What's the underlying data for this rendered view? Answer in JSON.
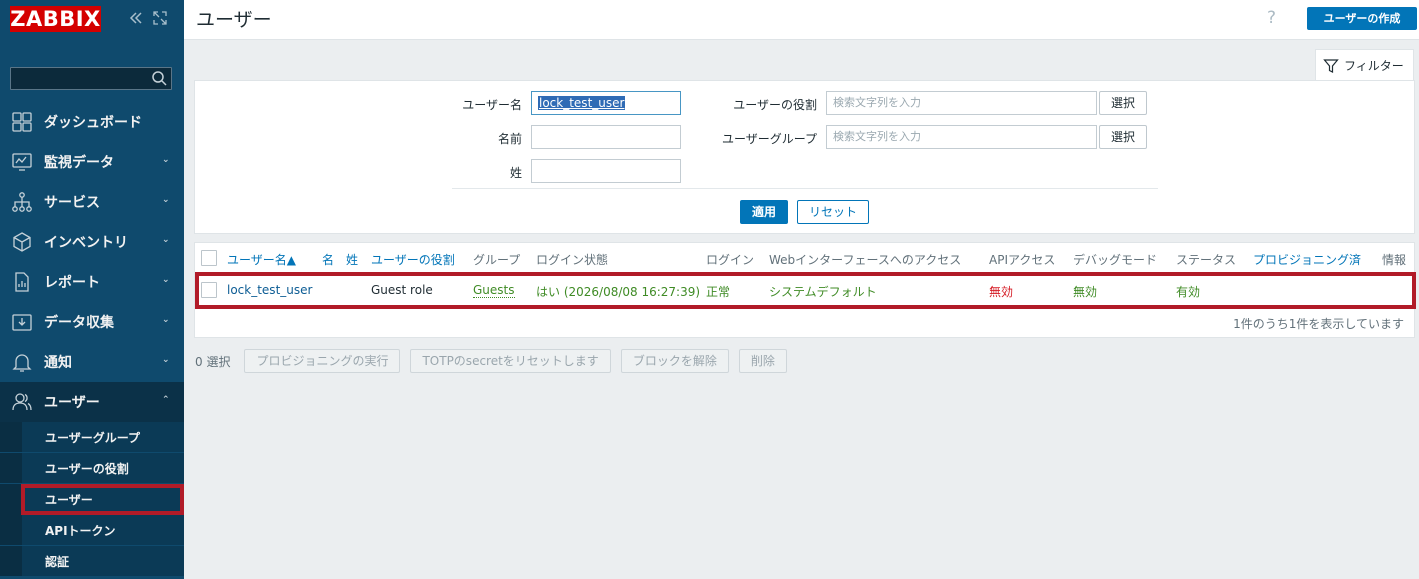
{
  "sidebar": {
    "logo": "ZABBIX",
    "search_placeholder": "",
    "menu": [
      {
        "label": "ダッシュボード",
        "icon": "dashboard-icon"
      },
      {
        "label": "監視データ",
        "icon": "monitoring-icon"
      },
      {
        "label": "サービス",
        "icon": "services-icon"
      },
      {
        "label": "インベントリ",
        "icon": "inventory-icon"
      },
      {
        "label": "レポート",
        "icon": "reports-icon"
      },
      {
        "label": "データ収集",
        "icon": "data-collection-icon"
      },
      {
        "label": "通知",
        "icon": "alerts-bell-icon"
      },
      {
        "label": "ユーザー",
        "icon": "users-icon"
      }
    ],
    "submenu": [
      "ユーザーグループ",
      "ユーザーの役割",
      "ユーザー",
      "APIトークン",
      "認証"
    ]
  },
  "header": {
    "title": "ユーザー",
    "help": "?",
    "create_button": "ユーザーの作成"
  },
  "filter": {
    "tab_label": "フィルター",
    "username_label": "ユーザー名",
    "username_value": "lock_test_user",
    "name_label": "名前",
    "name_value": "",
    "surname_label": "姓",
    "surname_value": "",
    "role_label": "ユーザーの役割",
    "role_placeholder": "検索文字列を入力",
    "group_label": "ユーザーグループ",
    "group_placeholder": "検索文字列を入力",
    "select_label": "選択",
    "apply_label": "適用",
    "reset_label": "リセット"
  },
  "table": {
    "headers": {
      "username": "ユーザー名▲",
      "name": "名",
      "surname": "姓",
      "role": "ユーザーの役割",
      "groups": "グループ",
      "is_online": "ログイン状態",
      "login": "ログイン",
      "frontend_access": "Webインターフェースへのアクセス",
      "api_access": "APIアクセス",
      "debug_mode": "デバッグモード",
      "status": "ステータス",
      "provisioned": "プロビジョニング済",
      "info": "情報"
    },
    "rows": [
      {
        "username": "lock_test_user",
        "name": "",
        "surname": "",
        "role": "Guest role",
        "groups": "Guests",
        "is_online": "はい (2026/08/08 16:27:39)",
        "login": "正常",
        "frontend_access": "システムデフォルト",
        "api_access": "無効",
        "debug_mode": "無効",
        "status": "有効",
        "provisioned": "",
        "info": ""
      }
    ],
    "footer": "1件のうち1件を表示しています"
  },
  "actions": {
    "selected_count": "0 選択",
    "provision": "プロビジョニングの実行",
    "reset_totp": "TOTPのsecretをリセットします",
    "unblock": "ブロックを解除",
    "delete": "削除"
  },
  "colors": {
    "sidebar_bg": "#0f4a6d",
    "brand_red": "#d40000",
    "primary_blue": "#0275b8",
    "ok_green": "#3f8b25",
    "disabled_red": "#d51b24",
    "highlight_red": "#b11b28"
  }
}
